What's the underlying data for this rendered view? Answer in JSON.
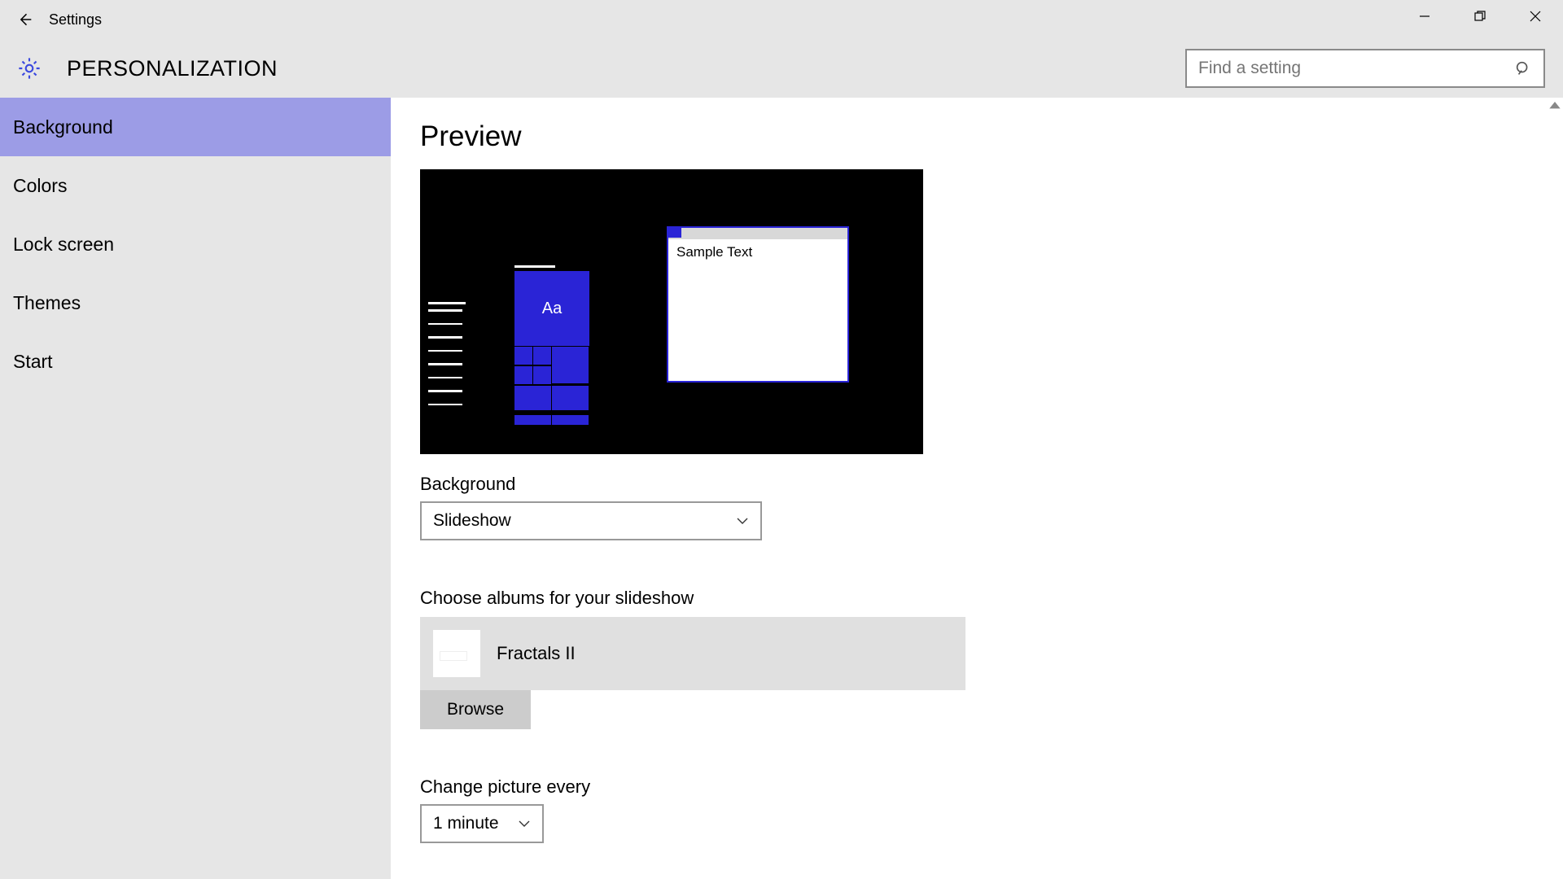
{
  "window": {
    "title": "Settings"
  },
  "header": {
    "title": "PERSONALIZATION",
    "search_placeholder": "Find a setting"
  },
  "sidebar": {
    "items": [
      {
        "label": "Background",
        "active": true
      },
      {
        "label": "Colors"
      },
      {
        "label": "Lock screen"
      },
      {
        "label": "Themes"
      },
      {
        "label": "Start"
      }
    ]
  },
  "content": {
    "preview_heading": "Preview",
    "sample_text": "Sample Text",
    "aa_text": "Aa",
    "background_label": "Background",
    "background_value": "Slideshow",
    "albums_label": "Choose albums for your slideshow",
    "album_name": "Fractals II",
    "browse_label": "Browse",
    "change_every_label": "Change picture every",
    "change_every_value": "1 minute"
  },
  "colors": {
    "accent": "#2a24d6",
    "sidebar_active": "#9c9ce6"
  }
}
